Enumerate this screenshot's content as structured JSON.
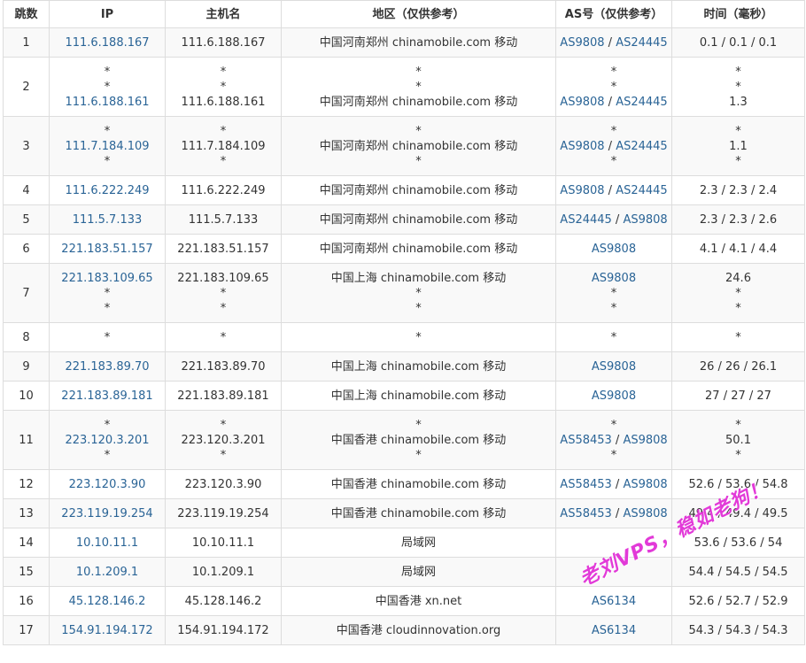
{
  "table": {
    "headers": [
      "跳数",
      "IP",
      "主机名",
      "地区（仅供参考）",
      "AS号（仅供参考）",
      "时间（毫秒）"
    ],
    "rows": [
      {
        "hop": "1",
        "ip": [
          "111.6.188.167"
        ],
        "host": [
          "111.6.188.167"
        ],
        "region": [
          "中国河南郑州 chinamobile.com 移动"
        ],
        "as": [
          [
            "AS9808",
            "AS24445"
          ]
        ],
        "time": [
          "0.1 / 0.1 / 0.1"
        ]
      },
      {
        "hop": "2",
        "ip": [
          "*",
          "*",
          "111.6.188.161"
        ],
        "host": [
          "*",
          "*",
          "111.6.188.161"
        ],
        "region": [
          "*",
          "*",
          "中国河南郑州 chinamobile.com 移动"
        ],
        "as": [
          [
            "*"
          ],
          [
            "*"
          ],
          [
            "AS9808",
            "AS24445"
          ]
        ],
        "time": [
          "*",
          "*",
          "1.3"
        ]
      },
      {
        "hop": "3",
        "ip": [
          "*",
          "111.7.184.109",
          "*"
        ],
        "host": [
          "*",
          "111.7.184.109",
          "*"
        ],
        "region": [
          "*",
          "中国河南郑州 chinamobile.com 移动",
          "*"
        ],
        "as": [
          [
            "*"
          ],
          [
            "AS9808",
            "AS24445"
          ],
          [
            "*"
          ]
        ],
        "time": [
          "*",
          "1.1",
          "*"
        ]
      },
      {
        "hop": "4",
        "ip": [
          "111.6.222.249"
        ],
        "host": [
          "111.6.222.249"
        ],
        "region": [
          "中国河南郑州 chinamobile.com 移动"
        ],
        "as": [
          [
            "AS9808",
            "AS24445"
          ]
        ],
        "time": [
          "2.3 / 2.3 / 2.4"
        ]
      },
      {
        "hop": "5",
        "ip": [
          "111.5.7.133"
        ],
        "host": [
          "111.5.7.133"
        ],
        "region": [
          "中国河南郑州 chinamobile.com 移动"
        ],
        "as": [
          [
            "AS24445",
            "AS9808"
          ]
        ],
        "time": [
          "2.3 / 2.3 / 2.6"
        ]
      },
      {
        "hop": "6",
        "ip": [
          "221.183.51.157"
        ],
        "host": [
          "221.183.51.157"
        ],
        "region": [
          "中国河南郑州 chinamobile.com 移动"
        ],
        "as": [
          [
            "AS9808"
          ]
        ],
        "time": [
          "4.1 / 4.1 / 4.4"
        ]
      },
      {
        "hop": "7",
        "ip": [
          "221.183.109.65",
          "*",
          "*"
        ],
        "host": [
          "221.183.109.65",
          "*",
          "*"
        ],
        "region": [
          "中国上海 chinamobile.com 移动",
          "*",
          "*"
        ],
        "as": [
          [
            "AS9808"
          ],
          [
            "*"
          ],
          [
            "*"
          ]
        ],
        "time": [
          "24.6",
          "*",
          "*"
        ]
      },
      {
        "hop": "8",
        "ip": [
          "*"
        ],
        "host": [
          "*"
        ],
        "region": [
          "*"
        ],
        "as": [
          [
            "*"
          ]
        ],
        "time": [
          "*"
        ]
      },
      {
        "hop": "9",
        "ip": [
          "221.183.89.70"
        ],
        "host": [
          "221.183.89.70"
        ],
        "region": [
          "中国上海 chinamobile.com 移动"
        ],
        "as": [
          [
            "AS9808"
          ]
        ],
        "time": [
          "26 / 26 / 26.1"
        ]
      },
      {
        "hop": "10",
        "ip": [
          "221.183.89.181"
        ],
        "host": [
          "221.183.89.181"
        ],
        "region": [
          "中国上海 chinamobile.com 移动"
        ],
        "as": [
          [
            "AS9808"
          ]
        ],
        "time": [
          "27 / 27 / 27"
        ]
      },
      {
        "hop": "11",
        "ip": [
          "*",
          "223.120.3.201",
          "*"
        ],
        "host": [
          "*",
          "223.120.3.201",
          "*"
        ],
        "region": [
          "*",
          "中国香港 chinamobile.com 移动",
          "*"
        ],
        "as": [
          [
            "*"
          ],
          [
            "AS58453",
            "AS9808"
          ],
          [
            "*"
          ]
        ],
        "time": [
          "*",
          "50.1",
          "*"
        ]
      },
      {
        "hop": "12",
        "ip": [
          "223.120.3.90"
        ],
        "host": [
          "223.120.3.90"
        ],
        "region": [
          "中国香港 chinamobile.com 移动"
        ],
        "as": [
          [
            "AS58453",
            "AS9808"
          ]
        ],
        "time": [
          "52.6 / 53.6 / 54.8"
        ]
      },
      {
        "hop": "13",
        "ip": [
          "223.119.19.254"
        ],
        "host": [
          "223.119.19.254"
        ],
        "region": [
          "中国香港 chinamobile.com 移动"
        ],
        "as": [
          [
            "AS58453",
            "AS9808"
          ]
        ],
        "time": [
          "49.4 / 49.4 / 49.5"
        ]
      },
      {
        "hop": "14",
        "ip": [
          "10.10.11.1"
        ],
        "host": [
          "10.10.11.1"
        ],
        "region": [
          "局域网"
        ],
        "as": [
          []
        ],
        "time": [
          "53.6 / 53.6 / 54"
        ]
      },
      {
        "hop": "15",
        "ip": [
          "10.1.209.1"
        ],
        "host": [
          "10.1.209.1"
        ],
        "region": [
          "局域网"
        ],
        "as": [
          []
        ],
        "time": [
          "54.4 / 54.5 / 54.5"
        ]
      },
      {
        "hop": "16",
        "ip": [
          "45.128.146.2"
        ],
        "host": [
          "45.128.146.2"
        ],
        "region": [
          "中国香港 xn.net"
        ],
        "as": [
          [
            "AS6134"
          ]
        ],
        "time": [
          "52.6 / 52.7 / 52.9"
        ]
      },
      {
        "hop": "17",
        "ip": [
          "154.91.194.172"
        ],
        "host": [
          "154.91.194.172"
        ],
        "region": [
          "中国香港 cloudinnovation.org"
        ],
        "as": [
          [
            "AS6134"
          ]
        ],
        "time": [
          "54.3 / 54.3 / 54.3"
        ]
      }
    ]
  },
  "watermark": "老刘VPS，稳如老狗！",
  "colors": {
    "link": "#2a6496",
    "border": "#dddddd",
    "stripe": "#f9f9f9",
    "watermark": "#e23ad8"
  }
}
